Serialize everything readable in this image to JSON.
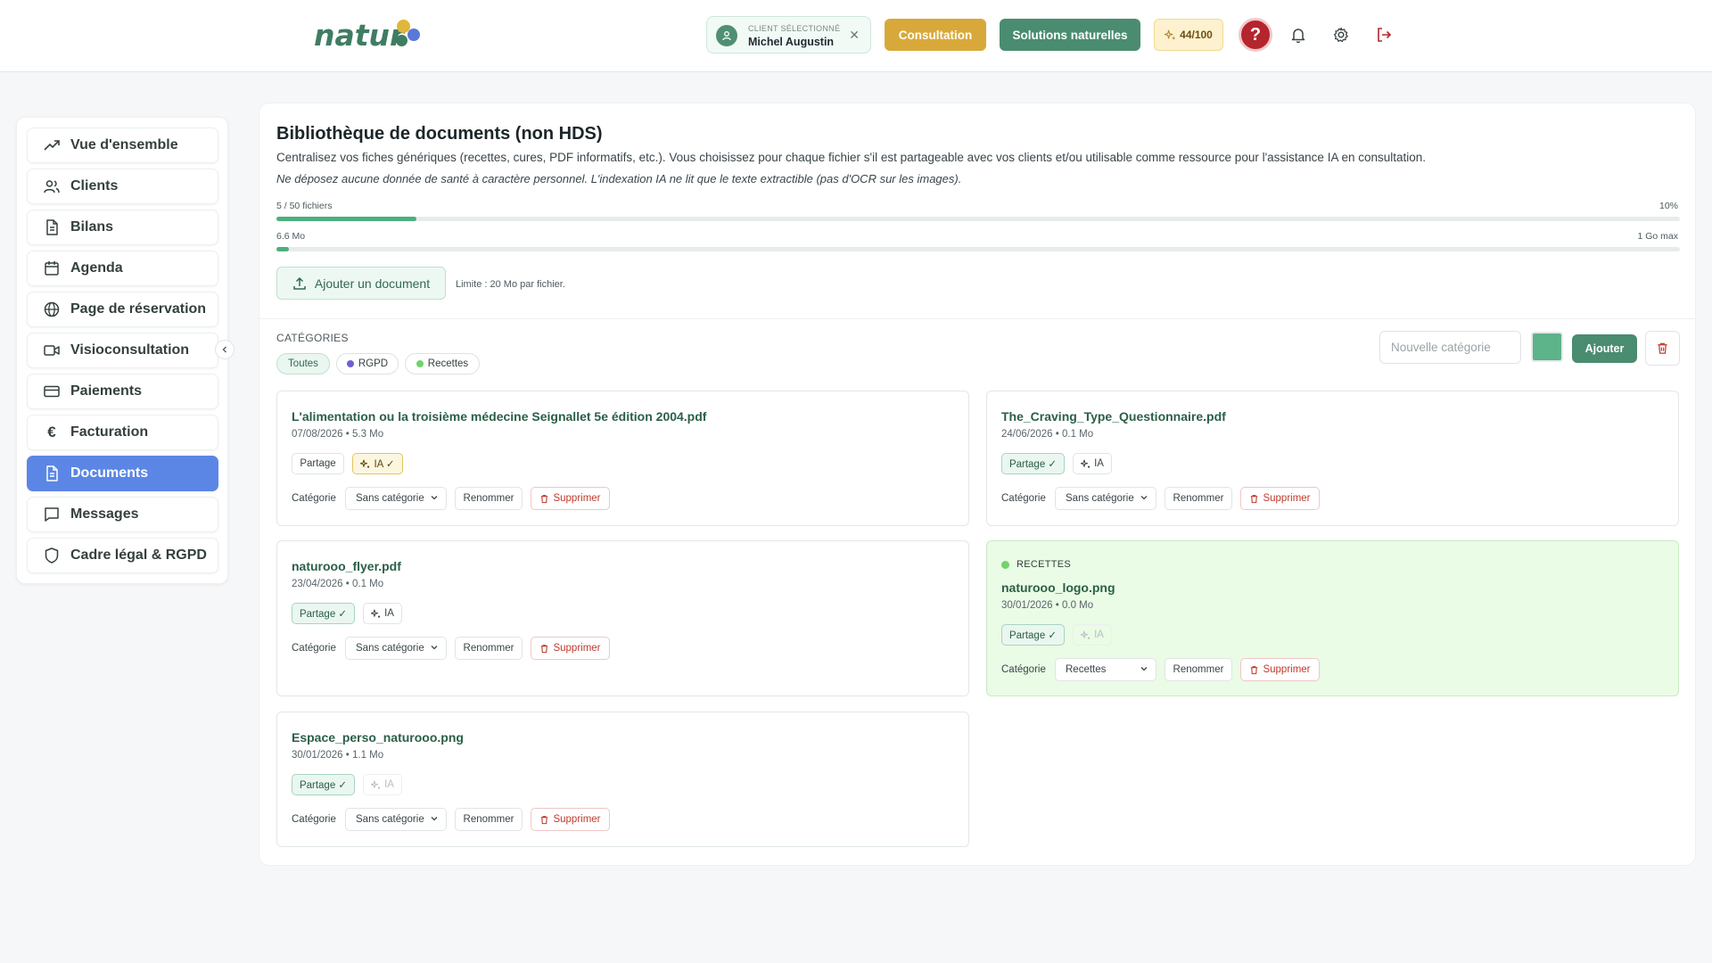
{
  "header": {
    "logo_text": "natur",
    "client_caption": "CLIENT SÉLECTIONNÉ",
    "client_name": "Michel Augustin",
    "consultation_label": "Consultation",
    "solutions_label": "Solutions naturelles",
    "credits": "44/100",
    "help_glyph": "?",
    "icons": [
      "user-icon",
      "close-icon",
      "sparkles-icon",
      "help-icon",
      "bell-icon",
      "gear-icon",
      "logout-icon"
    ],
    "colors": {
      "accent_green": "#4a8c70",
      "accent_gold": "#d8a93a",
      "help_red": "#b5252d"
    }
  },
  "sidebar": {
    "items": [
      {
        "label": "Vue d'ensemble",
        "icon": "trending-up-icon",
        "active": false
      },
      {
        "label": "Clients",
        "icon": "users-icon",
        "active": false
      },
      {
        "label": "Bilans",
        "icon": "document-icon",
        "active": false
      },
      {
        "label": "Agenda",
        "icon": "calendar-icon",
        "active": false
      },
      {
        "label": "Page de réservation",
        "icon": "globe-icon",
        "active": false
      },
      {
        "label": "Visioconsultation",
        "icon": "video-icon",
        "active": false
      },
      {
        "label": "Paiements",
        "icon": "credit-card-icon",
        "active": false
      },
      {
        "label": "Facturation",
        "icon": "euro-icon",
        "active": false
      },
      {
        "label": "Documents",
        "icon": "document-icon",
        "active": true
      },
      {
        "label": "Messages",
        "icon": "message-icon",
        "active": false
      },
      {
        "label": "Cadre légal & RGPD",
        "icon": "shield-icon",
        "active": false
      }
    ],
    "active_color": "#5b86e5"
  },
  "main": {
    "title": "Bibliothèque de documents (non HDS)",
    "description": "Centralisez vos fiches génériques (recettes, cures, PDF informatifs, etc.). Vous choisissez pour chaque fichier s'il est partageable avec vos clients et/ou utilisable comme ressource pour l'assistance IA en consultation.",
    "warning": "Ne déposez aucune donnée de santé à caractère personnel. L'indexation IA ne lit que le texte extractible (pas d'OCR sur les images).",
    "files_usage": {
      "label": "5 / 50 fichiers",
      "percent_label": "10%",
      "fraction": 0.1
    },
    "storage_usage": {
      "label": "6.6 Mo",
      "max_label": "1 Go max",
      "fraction": 0.0066
    },
    "upload_label": "Ajouter un document",
    "upload_limit": "Limite : 20 Mo par fichier.",
    "categories_heading": "CATÉGORIES",
    "category_filters": [
      {
        "label": "Toutes",
        "color": null,
        "active": true
      },
      {
        "label": "RGPD",
        "color": "#6b5fd6",
        "active": false
      },
      {
        "label": "Recettes",
        "color": "#6fd46a",
        "active": false
      }
    ],
    "new_category_placeholder": "Nouvelle catégorie",
    "new_category_color": "#5db38a",
    "add_category_label": "Ajouter"
  },
  "documents": [
    {
      "name": "L'alimentation ou la troisième médecine Seignallet 5e édition 2004.pdf",
      "meta": "07/08/2026 • 5.3 Mo",
      "share_label": "Partage",
      "share_on": false,
      "ia_label": "IA ✓",
      "ia_on": true,
      "ia_dim": false,
      "category_label": "Catégorie",
      "category_value": "Sans catégorie",
      "rename_label": "Renommer",
      "delete_label": "Supprimer",
      "category_tag": null
    },
    {
      "name": "The_Craving_Type_Questionnaire.pdf",
      "meta": "24/06/2026 • 0.1 Mo",
      "share_label": "Partage ✓",
      "share_on": true,
      "ia_label": "IA",
      "ia_on": false,
      "ia_dim": false,
      "category_label": "Catégorie",
      "category_value": "Sans catégorie",
      "rename_label": "Renommer",
      "delete_label": "Supprimer",
      "category_tag": null
    },
    {
      "name": "naturooo_flyer.pdf",
      "meta": "23/04/2026 • 0.1 Mo",
      "share_label": "Partage ✓",
      "share_on": true,
      "ia_label": "IA",
      "ia_on": false,
      "ia_dim": false,
      "category_label": "Catégorie",
      "category_value": "Sans catégorie",
      "rename_label": "Renommer",
      "delete_label": "Supprimer",
      "category_tag": null
    },
    {
      "name": "naturooo_logo.png",
      "meta": "30/01/2026 • 0.0 Mo",
      "share_label": "Partage ✓",
      "share_on": true,
      "ia_label": "IA",
      "ia_on": false,
      "ia_dim": true,
      "category_label": "Catégorie",
      "category_value": "Recettes",
      "rename_label": "Renommer",
      "delete_label": "Supprimer",
      "category_tag": "RECETTES"
    },
    {
      "name": "Espace_perso_naturooo.png",
      "meta": "30/01/2026 • 1.1 Mo",
      "share_label": "Partage ✓",
      "share_on": true,
      "ia_label": "IA",
      "ia_on": false,
      "ia_dim": true,
      "category_label": "Catégorie",
      "category_value": "Sans catégorie",
      "rename_label": "Renommer",
      "delete_label": "Supprimer",
      "category_tag": null
    }
  ]
}
